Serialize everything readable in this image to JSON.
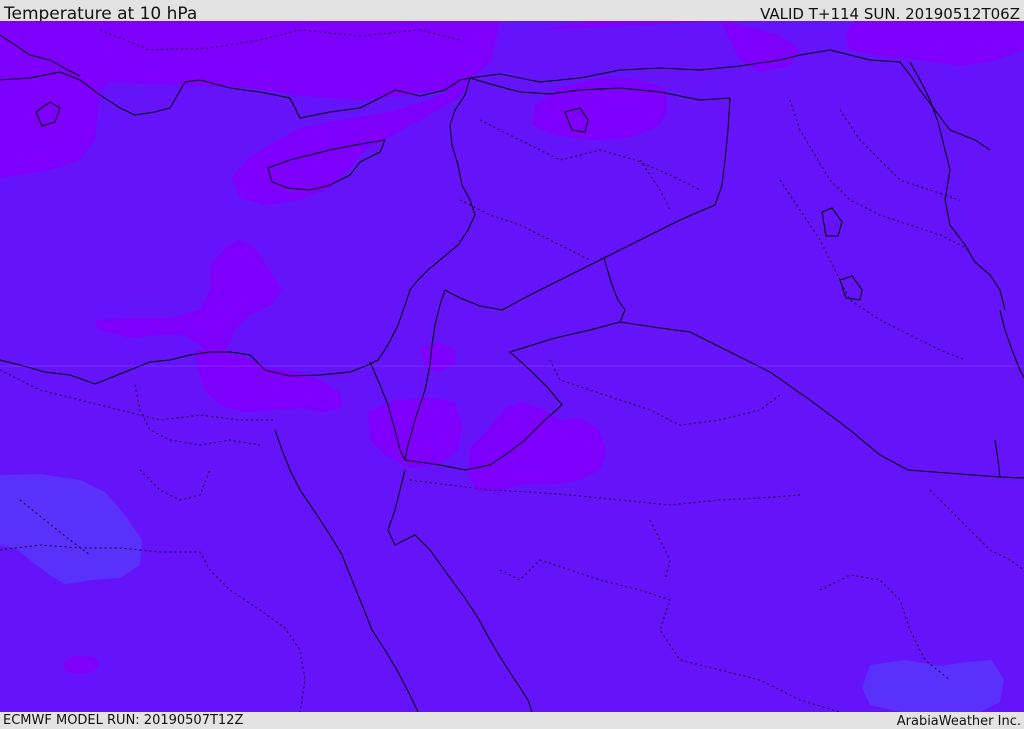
{
  "header": {
    "title": "Temperature at 10 hPa",
    "valid": "VALID T+114 SUN. 20190512T06Z"
  },
  "footer": {
    "model_run": "ECMWF MODEL RUN: 20190507T12Z",
    "credit": "ArabiaWeather Inc."
  },
  "map": {
    "colors": {
      "base_field": "#6514fa",
      "warm_field": "#7e00fc",
      "cool_field": "#5a30fb",
      "coastline": "#000000",
      "border": "#000000"
    }
  }
}
